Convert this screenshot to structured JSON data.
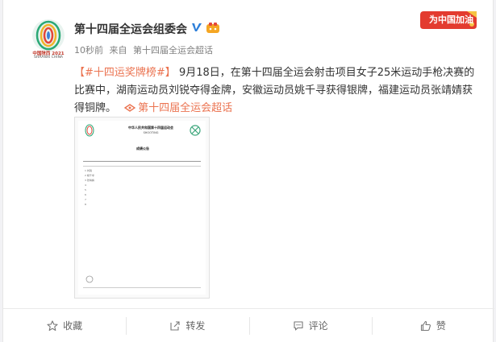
{
  "post": {
    "username": "第十四届全运会组委会",
    "time": "10秒前",
    "source_prefix": "来自",
    "source": "第十四届全运会超话",
    "corner_badge": "为中国加油",
    "avatar_caption": "中国陕西 2021",
    "avatar_caption_sub": "SHAANXI CHINA",
    "content": {
      "topic": "【#十四运奖牌榜#】",
      "text": "9月18日，在第十四届全运会射击项目女子25米运动手枪决赛的比赛中，湖南运动员刘锐夺得金牌，安徽运动员姚千寻获得银牌，福建运动员张靖婧获得铜牌。",
      "link": "第十四届全运会超话"
    },
    "document": {
      "title": "中华人民共和国第十四届运动会",
      "subtitle": "SHOOTING",
      "heading": "成绩公告",
      "rows": [
        "1  刘锐",
        "2  姚千寻",
        "3  张靖婧",
        "4",
        "5",
        "6",
        "7",
        "8"
      ]
    }
  },
  "actions": {
    "favorite": "收藏",
    "repost": "转发",
    "comment": "评论",
    "like": "赞"
  },
  "colors": {
    "accent": "#eb7350",
    "text": "#333333",
    "meta": "#808080"
  },
  "icons": [
    "favorite-star-icon",
    "repost-icon",
    "comment-icon",
    "like-thumb-icon",
    "verified-v-icon",
    "supertopic-link-icon"
  ]
}
